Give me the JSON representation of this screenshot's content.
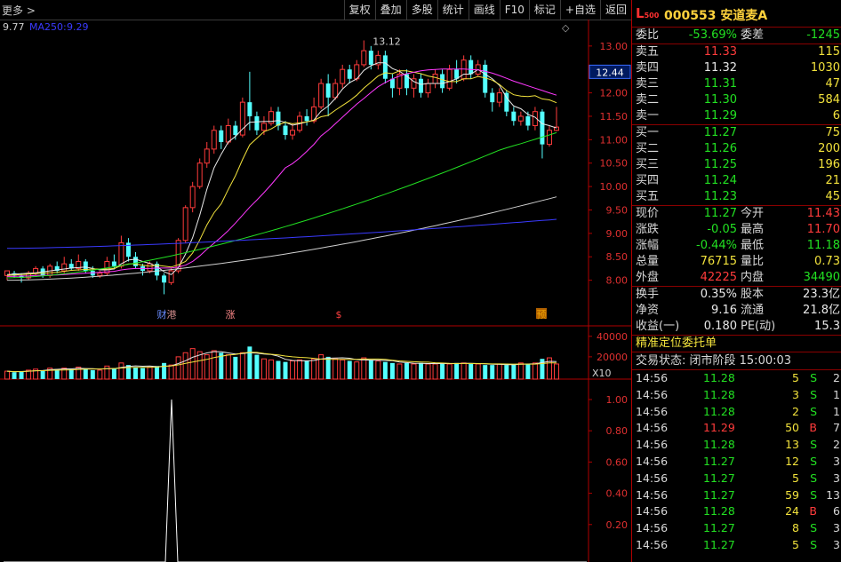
{
  "toolbar": {
    "more_label": "更多 >",
    "buttons": [
      "复权",
      "叠加",
      "多股",
      "统计",
      "画线",
      "F10",
      "标记",
      "+自选",
      "返回"
    ]
  },
  "chart_header": {
    "price_low": "9.77",
    "ma_label": "MA250:",
    "ma_value": "9.29"
  },
  "price_axis": {
    "ticks": [
      "13.00",
      "12.50",
      "12.00",
      "11.50",
      "11.00",
      "10.50",
      "10.00",
      "9.50",
      "9.00",
      "8.50",
      "8.00"
    ],
    "marker": "12.44",
    "peak_label": "13.12"
  },
  "volume_axis": {
    "ticks": [
      "40000",
      "20000"
    ],
    "unit": "X10"
  },
  "indicator_axis": {
    "ticks": [
      "1.00",
      "0.80",
      "0.60",
      "0.40",
      "0.20"
    ]
  },
  "event_marks": [
    "财",
    "港",
    "涨",
    "$",
    "预"
  ],
  "colors": {
    "up": "#ff3b3b",
    "down": "#54ffff",
    "ma5": "#e8e8e8",
    "ma10": "#f2e23c",
    "ma20": "#ff38ff",
    "ma60": "#22e022",
    "ma120": "#d0d0d0",
    "ma250": "#3a3aff"
  },
  "chart_data": {
    "type": "candlestick",
    "ylim": [
      7.5,
      13.3
    ],
    "candles": [
      [
        8.1,
        8.2,
        8.0,
        8.15
      ],
      [
        8.15,
        8.1,
        8.05,
        8.2
      ],
      [
        8.1,
        8.05,
        7.95,
        8.15
      ],
      [
        8.05,
        8.15,
        8.0,
        8.2
      ],
      [
        8.15,
        8.25,
        8.1,
        8.3
      ],
      [
        8.25,
        8.1,
        8.05,
        8.3
      ],
      [
        8.1,
        8.3,
        8.05,
        8.35
      ],
      [
        8.3,
        8.2,
        8.15,
        8.4
      ],
      [
        8.2,
        8.35,
        8.15,
        8.5
      ],
      [
        8.35,
        8.25,
        8.2,
        8.45
      ],
      [
        8.25,
        8.4,
        8.2,
        8.55
      ],
      [
        8.4,
        8.2,
        8.15,
        8.45
      ],
      [
        8.2,
        8.1,
        8.05,
        8.3
      ],
      [
        8.1,
        8.15,
        8.05,
        8.2
      ],
      [
        8.15,
        8.4,
        8.1,
        8.5
      ],
      [
        8.4,
        8.3,
        8.25,
        8.55
      ],
      [
        8.3,
        8.8,
        8.25,
        8.95
      ],
      [
        8.8,
        8.5,
        8.4,
        8.9
      ],
      [
        8.5,
        8.3,
        8.25,
        8.6
      ],
      [
        8.3,
        8.2,
        8.1,
        8.35
      ],
      [
        8.2,
        8.35,
        8.15,
        8.4
      ],
      [
        8.35,
        8.1,
        8.0,
        8.4
      ],
      [
        8.1,
        7.95,
        7.7,
        8.15
      ],
      [
        7.95,
        8.2,
        7.9,
        8.25
      ],
      [
        8.2,
        8.85,
        8.15,
        8.9
      ],
      [
        8.85,
        9.55,
        8.8,
        9.6
      ],
      [
        9.55,
        10.0,
        9.45,
        10.1
      ],
      [
        10.0,
        10.5,
        9.95,
        10.6
      ],
      [
        10.5,
        10.8,
        10.4,
        10.95
      ],
      [
        10.8,
        11.2,
        10.7,
        11.3
      ],
      [
        11.2,
        10.95,
        10.8,
        11.3
      ],
      [
        10.95,
        11.3,
        10.9,
        11.45
      ],
      [
        11.3,
        11.1,
        11.0,
        11.4
      ],
      [
        11.1,
        11.8,
        11.05,
        11.9
      ],
      [
        11.8,
        11.5,
        11.2,
        12.45
      ],
      [
        11.5,
        11.2,
        11.1,
        11.6
      ],
      [
        11.2,
        11.35,
        11.1,
        11.5
      ],
      [
        11.35,
        11.6,
        11.3,
        11.7
      ],
      [
        11.6,
        11.3,
        11.2,
        11.7
      ],
      [
        11.3,
        11.1,
        11.0,
        11.4
      ],
      [
        11.1,
        11.2,
        11.0,
        11.35
      ],
      [
        11.2,
        11.5,
        11.15,
        11.6
      ],
      [
        11.5,
        11.4,
        11.3,
        11.65
      ],
      [
        11.4,
        11.7,
        11.35,
        11.9
      ],
      [
        11.7,
        12.2,
        11.65,
        12.3
      ],
      [
        12.2,
        11.9,
        11.5,
        12.4
      ],
      [
        11.9,
        12.2,
        11.85,
        12.3
      ],
      [
        12.2,
        12.5,
        12.1,
        12.6
      ],
      [
        12.5,
        12.3,
        12.2,
        12.6
      ],
      [
        12.3,
        12.6,
        12.25,
        12.7
      ],
      [
        12.6,
        12.9,
        12.55,
        13.12
      ],
      [
        12.9,
        12.6,
        12.5,
        13.0
      ],
      [
        12.6,
        12.8,
        12.5,
        12.9
      ],
      [
        12.8,
        12.3,
        12.2,
        12.9
      ],
      [
        12.3,
        12.1,
        11.9,
        12.4
      ],
      [
        12.1,
        12.4,
        11.95,
        12.5
      ],
      [
        12.4,
        12.1,
        11.95,
        12.5
      ],
      [
        12.1,
        12.3,
        11.9,
        12.4
      ],
      [
        12.3,
        12.0,
        11.9,
        12.4
      ],
      [
        12.0,
        12.2,
        11.9,
        12.3
      ],
      [
        12.2,
        12.4,
        12.1,
        12.5
      ],
      [
        12.4,
        12.1,
        12.0,
        12.5
      ],
      [
        12.1,
        12.5,
        12.05,
        12.6
      ],
      [
        12.5,
        12.3,
        12.2,
        12.7
      ],
      [
        12.3,
        12.7,
        12.25,
        12.8
      ],
      [
        12.7,
        12.4,
        12.3,
        12.8
      ],
      [
        12.4,
        12.6,
        12.35,
        12.7
      ],
      [
        12.6,
        12.0,
        11.9,
        12.7
      ],
      [
        12.0,
        11.8,
        11.6,
        12.1
      ],
      [
        11.8,
        12.0,
        11.7,
        12.1
      ],
      [
        12.0,
        11.6,
        11.5,
        12.05
      ],
      [
        11.6,
        11.4,
        11.3,
        11.7
      ],
      [
        11.4,
        11.5,
        11.3,
        11.6
      ],
      [
        11.5,
        11.3,
        11.2,
        11.6
      ],
      [
        11.3,
        11.6,
        11.2,
        11.7
      ],
      [
        11.6,
        10.9,
        10.6,
        11.65
      ],
      [
        10.9,
        11.2,
        10.85,
        11.3
      ],
      [
        11.2,
        11.27,
        11.18,
        11.7
      ]
    ],
    "volumes": [
      6,
      5,
      6,
      7,
      8,
      7,
      9,
      8,
      9,
      8,
      10,
      8,
      7,
      7,
      11,
      9,
      14,
      12,
      10,
      9,
      10,
      11,
      14,
      12,
      20,
      24,
      28,
      25,
      22,
      26,
      24,
      22,
      20,
      24,
      30,
      22,
      18,
      17,
      16,
      15,
      16,
      17,
      16,
      18,
      22,
      20,
      18,
      17,
      16,
      15,
      19,
      17,
      16,
      15,
      14,
      13,
      14,
      13,
      14,
      13,
      13,
      14,
      13,
      14,
      14,
      13,
      13,
      12,
      12,
      13,
      12,
      13,
      14,
      13,
      14,
      18,
      19,
      13
    ],
    "ma_lines": {
      "ma5": [
        8.12,
        8.13,
        8.14,
        8.15,
        8.16,
        8.18,
        8.2,
        8.22,
        8.24,
        8.26,
        8.27,
        8.28,
        8.25,
        8.22,
        8.22,
        8.24,
        8.35,
        8.43,
        8.45,
        8.4,
        8.36,
        8.29,
        8.18,
        8.12,
        8.27,
        8.56,
        8.91,
        9.39,
        9.94,
        10.4,
        10.69,
        10.95,
        11.07,
        11.23,
        11.37,
        11.38,
        11.39,
        11.39,
        11.41,
        11.37,
        11.31,
        11.34,
        11.38,
        11.42,
        11.61,
        11.72,
        11.88,
        12.08,
        12.22,
        12.3,
        12.48,
        12.58,
        12.64,
        12.64,
        12.52,
        12.46,
        12.36,
        12.24,
        12.18,
        12.2,
        12.2,
        12.2,
        12.24,
        12.3,
        12.4,
        12.4,
        12.5,
        12.4,
        12.3,
        12.16,
        11.9,
        11.72,
        11.66,
        11.54,
        11.48,
        11.34,
        11.3,
        11.25
      ],
      "ma10": [
        8.1,
        8.11,
        8.12,
        8.13,
        8.14,
        8.15,
        8.16,
        8.17,
        8.19,
        8.21,
        8.22,
        8.23,
        8.24,
        8.24,
        8.24,
        8.25,
        8.31,
        8.35,
        8.35,
        8.32,
        8.3,
        8.32,
        8.3,
        8.28,
        8.33,
        8.4,
        8.58,
        8.86,
        9.18,
        9.44,
        9.63,
        9.94,
        10.23,
        10.58,
        10.89,
        11.03,
        11.17,
        11.23,
        11.32,
        11.37,
        11.34,
        11.36,
        11.38,
        11.41,
        11.49,
        11.52,
        11.63,
        11.73,
        11.83,
        11.95,
        12.1,
        12.23,
        12.36,
        12.43,
        12.41,
        12.47,
        12.47,
        12.44,
        12.41,
        12.36,
        12.33,
        12.28,
        12.24,
        12.24,
        12.3,
        12.3,
        12.35,
        12.32,
        12.27,
        12.18,
        12.05,
        11.96,
        11.93,
        11.92,
        11.94,
        11.87,
        11.85,
        11.79
      ],
      "ma20": [
        8.08,
        8.08,
        8.09,
        8.09,
        8.1,
        8.1,
        8.11,
        8.11,
        8.12,
        8.13,
        8.14,
        8.15,
        8.16,
        8.17,
        8.18,
        8.19,
        8.22,
        8.24,
        8.25,
        8.25,
        8.25,
        8.26,
        8.26,
        8.26,
        8.28,
        8.32,
        8.4,
        8.52,
        8.66,
        8.79,
        8.92,
        9.06,
        9.22,
        9.39,
        9.56,
        9.71,
        9.87,
        10.04,
        10.22,
        10.4,
        10.49,
        10.61,
        10.75,
        10.9,
        11.08,
        11.2,
        11.34,
        11.48,
        11.62,
        11.76,
        11.88,
        12.01,
        12.13,
        12.22,
        12.3,
        12.36,
        12.41,
        12.44,
        12.47,
        12.49,
        12.5,
        12.51,
        12.51,
        12.51,
        12.51,
        12.5,
        12.49,
        12.46,
        12.42,
        12.37,
        12.31,
        12.25,
        12.2,
        12.15,
        12.1,
        12.05,
        12.0,
        11.95
      ]
    }
  },
  "quote": {
    "code": "000553",
    "name": "安道麦A",
    "logo": "L",
    "logo_sub": "500",
    "weibi_label": "委比",
    "weibi": "-53.69%",
    "weicha_label": "委差",
    "weicha": "-1245",
    "asks": [
      {
        "label": "卖五",
        "price": "11.33",
        "vol": "115"
      },
      {
        "label": "卖四",
        "price": "11.32",
        "vol": "1030"
      },
      {
        "label": "卖三",
        "price": "11.31",
        "vol": "47"
      },
      {
        "label": "卖二",
        "price": "11.30",
        "vol": "584"
      },
      {
        "label": "卖一",
        "price": "11.29",
        "vol": "6"
      }
    ],
    "bids": [
      {
        "label": "买一",
        "price": "11.27",
        "vol": "75"
      },
      {
        "label": "买二",
        "price": "11.26",
        "vol": "200"
      },
      {
        "label": "买三",
        "price": "11.25",
        "vol": "196"
      },
      {
        "label": "买四",
        "price": "11.24",
        "vol": "21"
      },
      {
        "label": "买五",
        "price": "11.23",
        "vol": "45"
      }
    ],
    "stats1": [
      [
        "现价",
        "11.27",
        "今开",
        "11.43"
      ],
      [
        "涨跌",
        "-0.05",
        "最高",
        "11.70"
      ],
      [
        "涨幅",
        "-0.44%",
        "最低",
        "11.18"
      ],
      [
        "总量",
        "76715",
        "量比",
        "0.73"
      ],
      [
        "外盘",
        "42225",
        "内盘",
        "34490"
      ]
    ],
    "stats2": [
      [
        "换手",
        "0.35%",
        "股本",
        "23.3亿"
      ],
      [
        "净资",
        "9.16",
        "流通",
        "21.8亿"
      ],
      [
        "收益(一)",
        "0.180",
        "PE(动)",
        "15.3"
      ]
    ],
    "order_link": "精准定位委托单",
    "trade_status": "交易状态: 闭市阶段 15:00:03",
    "ticks": [
      [
        "14:56",
        "11.28",
        "5",
        "S",
        "2"
      ],
      [
        "14:56",
        "11.28",
        "3",
        "S",
        "1"
      ],
      [
        "14:56",
        "11.28",
        "2",
        "S",
        "1"
      ],
      [
        "14:56",
        "11.29",
        "50",
        "B",
        "7"
      ],
      [
        "14:56",
        "11.28",
        "13",
        "S",
        "2"
      ],
      [
        "14:56",
        "11.27",
        "12",
        "S",
        "3"
      ],
      [
        "14:56",
        "11.27",
        "5",
        "S",
        "3"
      ],
      [
        "14:56",
        "11.27",
        "59",
        "S",
        "13"
      ],
      [
        "14:56",
        "11.28",
        "24",
        "B",
        "6"
      ],
      [
        "14:56",
        "11.27",
        "8",
        "S",
        "3"
      ],
      [
        "14:56",
        "11.27",
        "5",
        "S",
        "3"
      ]
    ]
  }
}
